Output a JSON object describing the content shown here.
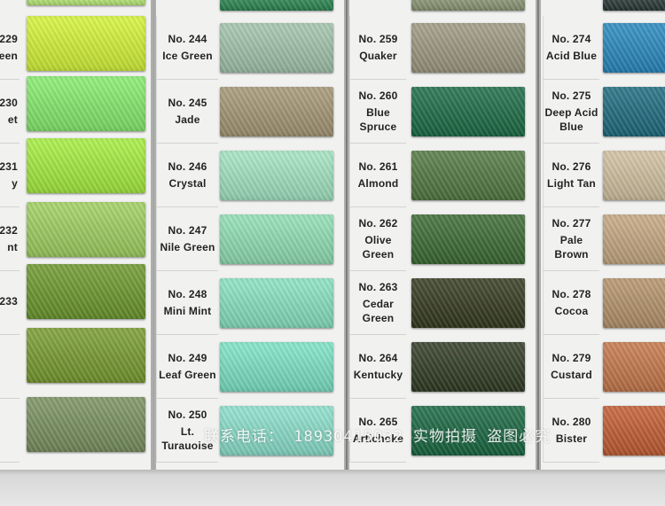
{
  "columns": [
    {
      "id": "col-a",
      "entries": [
        {
          "number": "229",
          "name": "reen",
          "color": "#c6f03c"
        },
        {
          "number": "230",
          "name": "et",
          "color": "#9ef58e"
        },
        {
          "number": "231",
          "name": "y",
          "color": "#a9f040"
        },
        {
          "number": "232",
          "name": "nt",
          "color": "#99c34f"
        },
        {
          "number": "233",
          "name": "",
          "color": "#5f8a2b"
        },
        {
          "number": "",
          "name": "",
          "color": "#78a02c"
        },
        {
          "number": "",
          "name": "",
          "color": "#6f8955"
        }
      ]
    },
    {
      "id": "col-b",
      "entries": [
        {
          "number": "No.  244",
          "name": "Ice Green",
          "color": "#a5c8af"
        },
        {
          "number": "No.  245",
          "name": "Jade",
          "color": "#a89a78"
        },
        {
          "number": "No.  246",
          "name": "Crystal",
          "color": "#a6e8c6"
        },
        {
          "number": "No.  247",
          "name": "Nile Green",
          "color": "#94e3b7"
        },
        {
          "number": "No.  248",
          "name": "Mini Mint",
          "color": "#8be6c5"
        },
        {
          "number": "No.  249",
          "name": "Leaf Green",
          "color": "#7fe7c8"
        },
        {
          "number": "No.  250",
          "name": "Lt. Turauoise",
          "color": "#8ee3cf"
        }
      ]
    },
    {
      "id": "col-c",
      "entries": [
        {
          "number": "No.  259",
          "name": "Quaker",
          "color": "#a09c84"
        },
        {
          "number": "No.  260",
          "name": "Blue Spruce",
          "color": "#1e6e48"
        },
        {
          "number": "No.  261",
          "name": "Almond",
          "color": "#547c44"
        },
        {
          "number": "No.  262",
          "name": "Olive Green",
          "color": "#3d6d35"
        },
        {
          "number": "No.  263",
          "name": "Cedar Green",
          "color": "#363c22"
        },
        {
          "number": "No.  264",
          "name": "Kentucky",
          "color": "#333d26"
        },
        {
          "number": "No.  265",
          "name": "Artichoke",
          "color": "#1b6a44"
        }
      ]
    },
    {
      "id": "col-d",
      "entries": [
        {
          "number": "No.  274",
          "name": "Acid Blue",
          "color": "#2a8bc2"
        },
        {
          "number": "No.  275",
          "name": "Deep Acid Blue",
          "color": "#1f6e82"
        },
        {
          "number": "No.  276",
          "name": "Light Tan",
          "color": "#d4c4a4"
        },
        {
          "number": "No.  277",
          "name": "Pale Brown",
          "color": "#c8ab84"
        },
        {
          "number": "No.  278",
          "name": "Cocoa",
          "color": "#b8966e"
        },
        {
          "number": "No.  279",
          "name": "Custard",
          "color": "#c87a4c"
        },
        {
          "number": "No.  280",
          "name": "Bister",
          "color": "#c65f34"
        }
      ]
    }
  ],
  "left_swatches": [
    {
      "color": "#bef07a"
    },
    {
      "color": "#d8f83a"
    },
    {
      "color": "#88f070"
    },
    {
      "color": "#a8f240"
    },
    {
      "color": "#a3d462"
    },
    {
      "color": "#6e9b2f"
    },
    {
      "color": "#7b9f31"
    },
    {
      "color": "#7c9463"
    }
  ],
  "top_partial": {
    "col_b_swatch_color": "#2e8a55",
    "col_c_swatch_color": "#8f9a78",
    "col_d_swatch_color": "#2a3a38"
  },
  "watermark": "联系电话： 18930415032  实物拍摄  盗图必究"
}
